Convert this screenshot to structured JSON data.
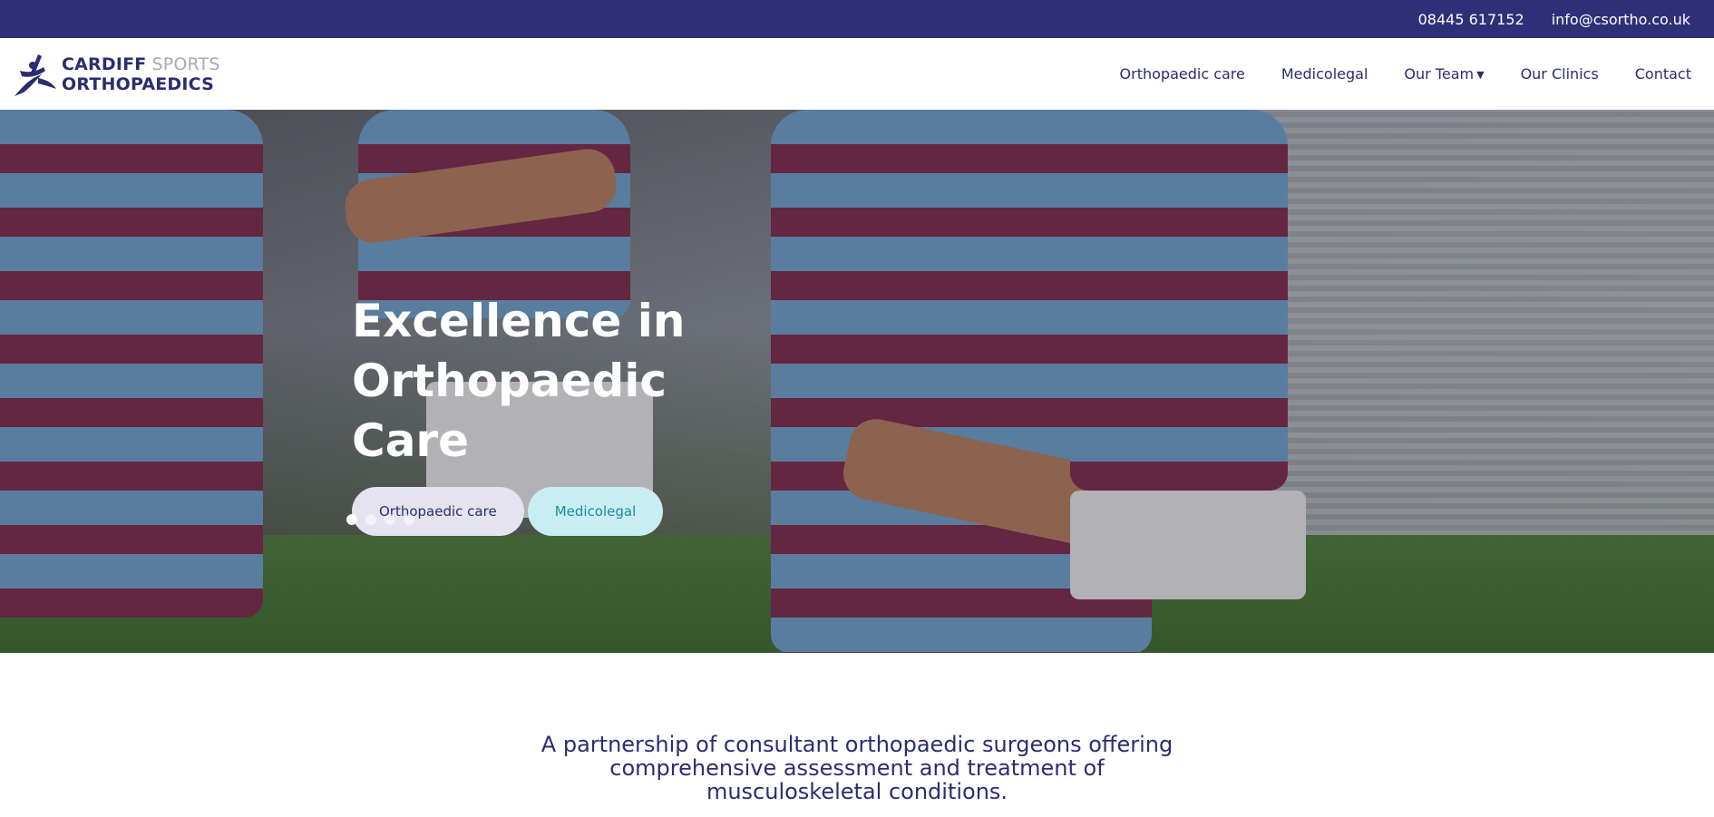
{
  "topbar": {
    "phone": "08445 617152",
    "email": "info@csortho.co.uk"
  },
  "logo": {
    "line1_a": "CARDIFF",
    "line1_b": "SPORTS",
    "line2": "ORTHOPAEDICS",
    "icon": "runner-logo-icon"
  },
  "nav": {
    "items": [
      {
        "label": "Orthopaedic care"
      },
      {
        "label": "Medicolegal"
      },
      {
        "label": "Our Team",
        "has_dropdown": true
      },
      {
        "label": "Our Clinics"
      },
      {
        "label": "Contact"
      }
    ],
    "dropdown_icon": "caret-down-icon"
  },
  "hero": {
    "title": "Excellence in Orthopaedic Care",
    "buttons": {
      "primary": "Orthopaedic care",
      "secondary": "Medicolegal"
    },
    "slides_count": 4,
    "active_slide": 1
  },
  "intro": {
    "text": "A partnership of consultant orthopaedic surgeons offering comprehensive assessment and treatment of musculoskeletal conditions."
  },
  "colors": {
    "brand": "#2f2f78",
    "text": "#2b2d72",
    "accent_light": "#c8eef3",
    "accent_text": "#1d8b9a"
  }
}
